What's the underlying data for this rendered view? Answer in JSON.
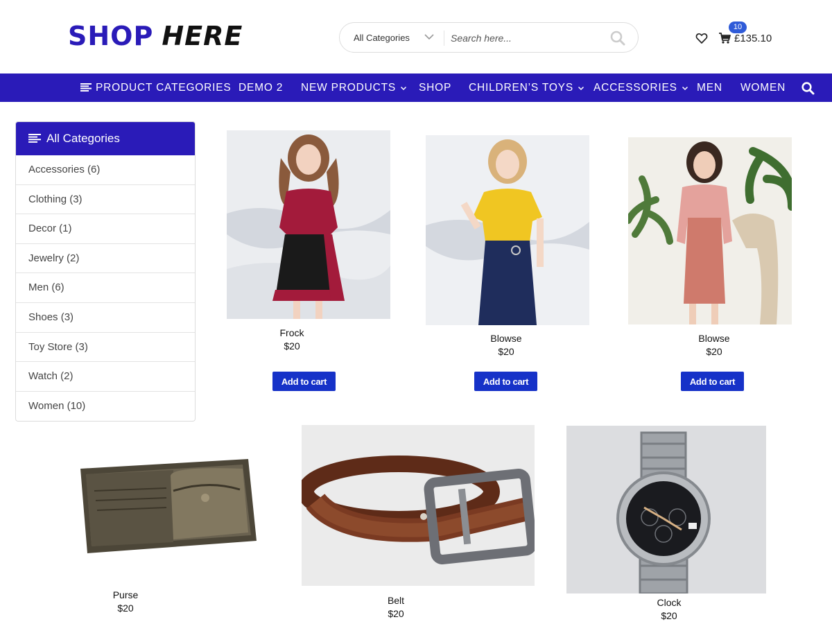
{
  "logo": {
    "part1": "SHOP",
    "part2": "HERE"
  },
  "search": {
    "category": "All Categories",
    "placeholder": "Search here..."
  },
  "cart": {
    "count": "10",
    "total": "£135.10"
  },
  "nav": {
    "product_categories": "PRODUCT CATEGORIES",
    "demo2": "DEMO 2",
    "new_products": "NEW PRODUCTS",
    "shop": "SHOP",
    "childrens_toys": "CHILDREN’S TOYS",
    "accessories": "ACCESSORIES",
    "men": "MEN",
    "women": "WOMEN"
  },
  "sidebar": {
    "title": "All Categories",
    "items": [
      "Accessories (6)",
      "Clothing (3)",
      "Decor (1)",
      "Jewelry (2)",
      "Men (6)",
      "Shoes (3)",
      "Toy Store (3)",
      "Watch (2)",
      "Women (10)"
    ]
  },
  "products": [
    {
      "name": "Frock",
      "price": "$20",
      "button": "Add to cart"
    },
    {
      "name": "Blowse",
      "price": "$20",
      "button": "Add to cart"
    },
    {
      "name": "Blowse",
      "price": "$20",
      "button": "Add to cart"
    },
    {
      "name": "Purse",
      "price": "$20"
    },
    {
      "name": "Belt",
      "price": "$20"
    },
    {
      "name": "Clock",
      "price": "$20"
    }
  ],
  "colors": {
    "brand": "#2a1bb8",
    "button": "#1632c8",
    "badge": "#2f5bd8"
  },
  "icons": [
    "menu-icon",
    "chevron-down-icon",
    "search-icon",
    "heart-icon",
    "cart-icon"
  ]
}
